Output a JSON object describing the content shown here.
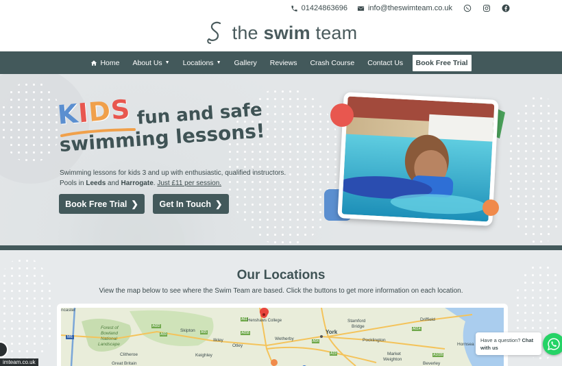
{
  "topbar": {
    "phone": "01424863696",
    "email": "info@theswimteam.co.uk"
  },
  "logo": {
    "prefix": "the",
    "bold": "swim",
    "suffix": "team"
  },
  "nav": {
    "items": [
      {
        "label": "Home"
      },
      {
        "label": "About Us"
      },
      {
        "label": "Locations"
      },
      {
        "label": "Gallery"
      },
      {
        "label": "Reviews"
      },
      {
        "label": "Crash Course"
      },
      {
        "label": "Contact Us"
      }
    ],
    "cta": "Book Free Trial"
  },
  "hero": {
    "kids_letters": [
      "K",
      "I",
      "D",
      "S"
    ],
    "headline_line1": "fun and safe",
    "headline_line2": "swimming lessons!",
    "sub_line1": "Swimming lessons for kids 3 and up with enthusiastic, qualified instructors.",
    "sub_line2_a": "Pools in ",
    "sub_loc1": "Leeds",
    "sub_and": " and ",
    "sub_loc2": "Harrogate",
    "sub_dot": ". ",
    "sub_price": "Just £11 per session.",
    "btn_trial": "Book Free Trial",
    "btn_touch": "Get In Touch",
    "colors": {
      "K": "#5b8fd0",
      "I": "#e8574f",
      "D": "#f0a04b",
      "S": "#e8574f",
      "accent_green": "#4aa05a",
      "accent_blue": "#5b8fd0",
      "accent_orange": "#f08a4b",
      "accent_red": "#e8574f"
    }
  },
  "locations": {
    "title": "Our Locations",
    "description": "View the map below to see where the Swim Team are based. Click the buttons to get more information on each location.",
    "map_labels": {
      "tl": "ncaster",
      "forest": "Forest of",
      "bowland": "Bowland",
      "national": "National",
      "landscape": "Landscape",
      "skipton": "Skipton",
      "ilkley": "Ilkley",
      "otley": "Otley",
      "keighley": "Keighley",
      "clitheroe": "Clitheroe",
      "wetherby": "Wetherby",
      "henshaws": "Henshaws College",
      "york": "York",
      "stamford": "Stamford",
      "bridge": "Bridge",
      "pocklington": "Pocklington",
      "driffield": "Driffield",
      "market": "Market",
      "weighton": "Weighton",
      "beverley": "Beverley",
      "hornsea": "Hornsea",
      "great_britain": "Great Britain",
      "m6": "M6",
      "a59": "A59",
      "a65": "A65",
      "a61": "A61",
      "a658": "A658",
      "a64": "A64",
      "a19": "A19",
      "a614": "A614",
      "a1035": "A1035",
      "a682": "A682"
    }
  },
  "chat": {
    "question": "Have a question?",
    "bold": "Chat",
    "with": "with us"
  },
  "status_url": "imteam.co.uk"
}
